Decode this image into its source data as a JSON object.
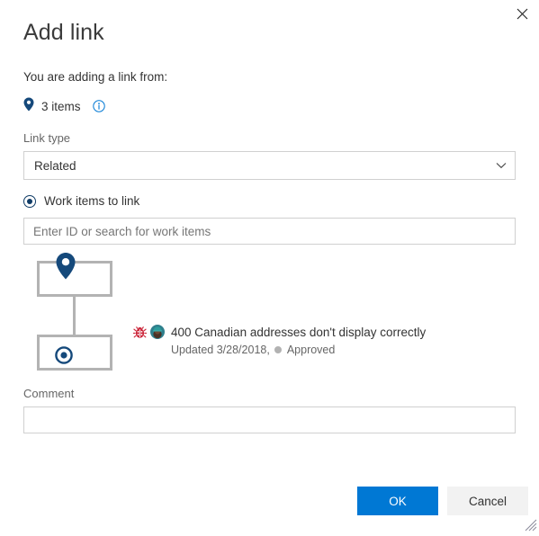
{
  "dialog": {
    "title": "Add link",
    "close_icon": "close-icon"
  },
  "source": {
    "description": "You are adding a link from:",
    "pin_icon": "location-pin-icon",
    "items_count_label": "3 items",
    "info_icon": "info-icon"
  },
  "link_type": {
    "label": "Link type",
    "selected": "Related",
    "chevron_icon": "chevron-down-icon"
  },
  "work_items": {
    "radio_label": "Work items to link",
    "radio_selected": true,
    "search_placeholder": "Enter ID or search for work items",
    "search_value": ""
  },
  "tree": {
    "source_node_icon": "location-pin-icon",
    "target_node_icon": "target-icon"
  },
  "work_item": {
    "type_icon": "bug-icon",
    "avatar_icon": "avatar-icon",
    "title": "400 Canadian addresses don't display correctly",
    "updated": "Updated 3/28/2018,",
    "state": "Approved",
    "state_dot_color": "#b2b2b2"
  },
  "comment": {
    "label": "Comment",
    "value": "",
    "placeholder": ""
  },
  "footer": {
    "ok_label": "OK",
    "cancel_label": "Cancel",
    "ok_color": "#0078d4",
    "cancel_color": "#f2f2f2",
    "resize_grip_icon": "resize-grip-icon"
  }
}
